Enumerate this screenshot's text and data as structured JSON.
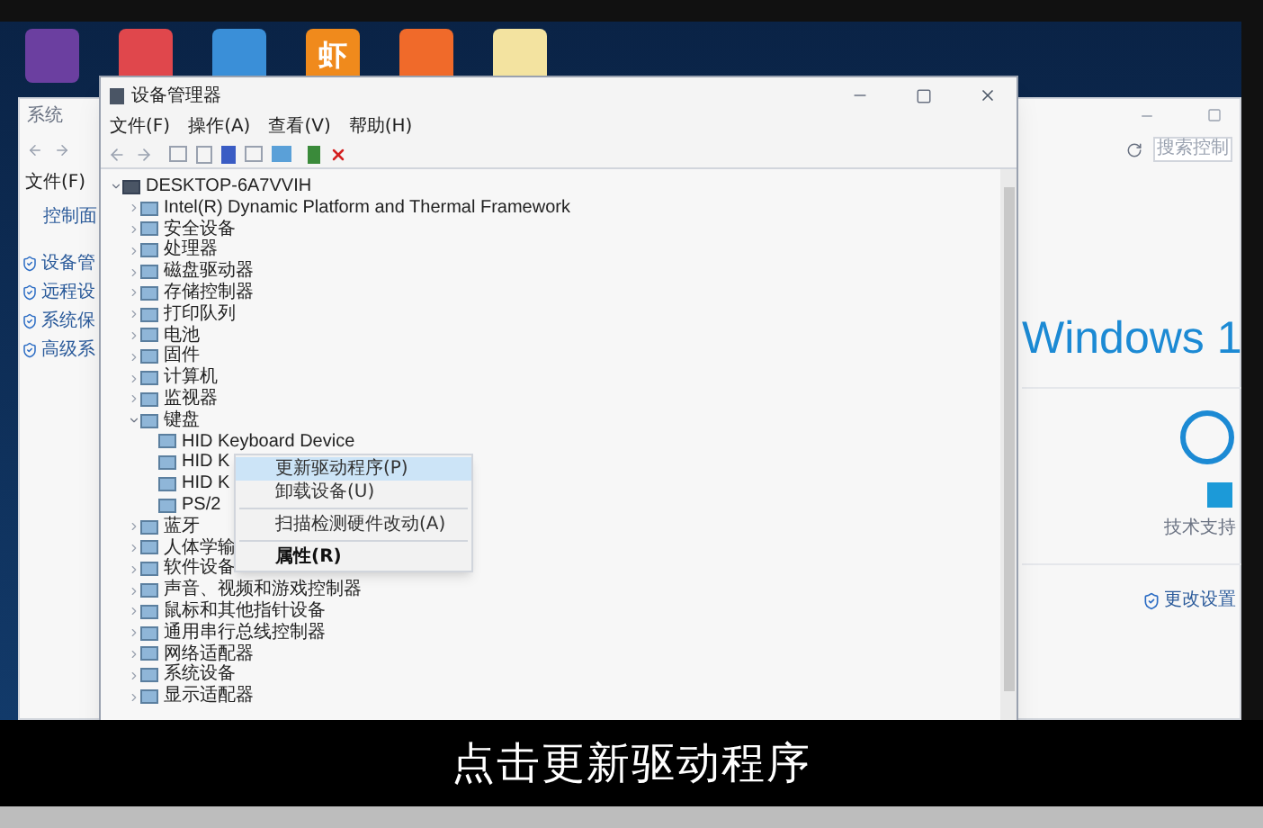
{
  "desktop_icons": [
    {
      "color": "#6b3fa0"
    },
    {
      "color": "#e0474c"
    },
    {
      "color": "#3a8fd8"
    },
    {
      "label": "虾",
      "color": "#f08a1c"
    },
    {
      "color": "#f06a2a"
    },
    {
      "color": "#f3e3a0"
    }
  ],
  "system_window": {
    "title": "系统",
    "search_placeholder": "搜索控制",
    "menu": "文件(F)",
    "home_link": "控制面",
    "links": [
      "设备管",
      "远程设",
      "系统保",
      "高级系"
    ],
    "brand": "Windows 1",
    "support": "技术支持",
    "change_settings": "更改设置"
  },
  "device_manager": {
    "title": "设备管理器",
    "menu": [
      "文件(F)",
      "操作(A)",
      "查看(V)",
      "帮助(H)"
    ],
    "tree": {
      "label": "DESKTOP-6A7VVIH",
      "expanded": true,
      "children": [
        {
          "label": "Intel(R) Dynamic Platform and Thermal Framework",
          "expanded": false
        },
        {
          "label": "安全设备",
          "expanded": false
        },
        {
          "label": "处理器",
          "expanded": false
        },
        {
          "label": "磁盘驱动器",
          "expanded": false
        },
        {
          "label": "存储控制器",
          "expanded": false
        },
        {
          "label": "打印队列",
          "expanded": false
        },
        {
          "label": "电池",
          "expanded": false
        },
        {
          "label": "固件",
          "expanded": false
        },
        {
          "label": "计算机",
          "expanded": false
        },
        {
          "label": "监视器",
          "expanded": false
        },
        {
          "label": "键盘",
          "expanded": true,
          "children": [
            {
              "label": "HID Keyboard Device"
            },
            {
              "label": "HID K"
            },
            {
              "label": "HID K"
            },
            {
              "label": "PS/2"
            }
          ]
        },
        {
          "label": "蓝牙",
          "expanded": false
        },
        {
          "label": "人体学输",
          "expanded": false
        },
        {
          "label": "软件设备",
          "expanded": false
        },
        {
          "label": "声音、视频和游戏控制器",
          "expanded": false
        },
        {
          "label": "鼠标和其他指针设备",
          "expanded": false
        },
        {
          "label": "通用串行总线控制器",
          "expanded": false
        },
        {
          "label": "网络适配器",
          "expanded": false
        },
        {
          "label": "系统设备",
          "expanded": false
        },
        {
          "label": "显示适配器",
          "expanded": false
        }
      ]
    },
    "context_menu": [
      {
        "label": "更新驱动程序(P)",
        "selected": true,
        "bold": false
      },
      {
        "label": "卸载设备(U)",
        "selected": false,
        "bold": false
      },
      {
        "label": "扫描检测硬件改动(A)",
        "selected": false,
        "bold": false
      },
      {
        "label": "属性(R)",
        "selected": false,
        "bold": true
      }
    ]
  },
  "caption": "点击更新驱动程序"
}
